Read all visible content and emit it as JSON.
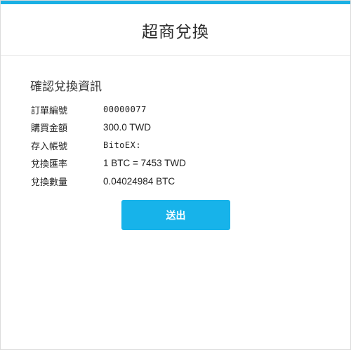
{
  "header": {
    "title": "超商兌換"
  },
  "confirm": {
    "title": "確認兌換資訊",
    "rows": [
      {
        "label": "訂單編號",
        "value": "00000077"
      },
      {
        "label": "購買金額",
        "value": "300.0 TWD"
      },
      {
        "label": "存入帳號",
        "value": "BitoEX:"
      },
      {
        "label": "兌換匯率",
        "value": "1 BTC = 7453 TWD"
      },
      {
        "label": "兌換數量",
        "value": "0.04024984 BTC"
      }
    ]
  },
  "actions": {
    "submit_label": "送出"
  },
  "colors": {
    "accent": "#1ab0e4",
    "button": "#17b3ea"
  }
}
